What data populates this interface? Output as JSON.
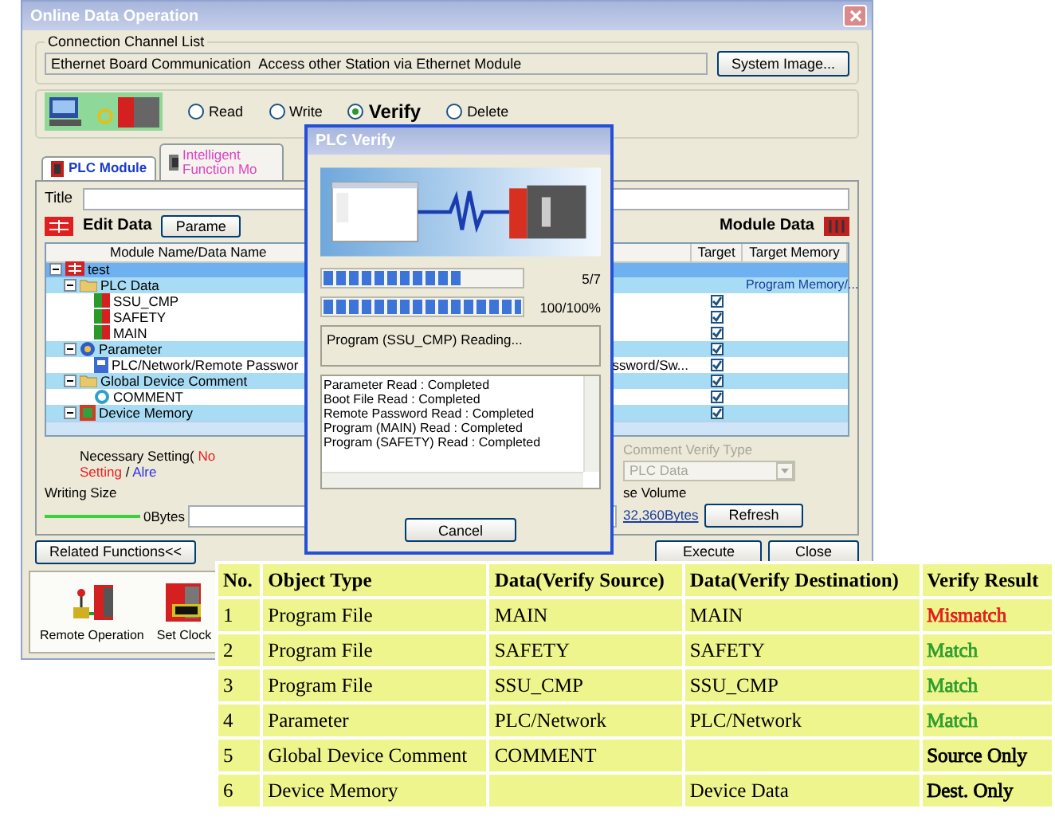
{
  "main_window": {
    "title": "Online Data Operation",
    "connection": {
      "label": "Connection Channel List",
      "value": "Ethernet Board Communication  Access other Station via Ethernet Module",
      "button": "System Image..."
    },
    "operations": [
      {
        "label": "Read",
        "selected": false
      },
      {
        "label": "Write",
        "selected": false
      },
      {
        "label": "Verify",
        "selected": true
      },
      {
        "label": "Delete",
        "selected": false
      }
    ],
    "tabs": [
      {
        "label": "PLC Module",
        "selected": true
      },
      {
        "label": "Intelligent Function Mo",
        "selected": false
      }
    ],
    "title_label": "Title",
    "edit_data": "Edit Data",
    "parameter_button": "Parame",
    "module_data": "Module Data",
    "tree": {
      "columns": [
        "Module Name/Data Name",
        "Target",
        "Target Memory"
      ],
      "items": [
        {
          "name": "test",
          "kind": "project",
          "selected": true,
          "expanded": true,
          "children": [
            {
              "name": "PLC Data",
              "kind": "folder",
              "selected": false,
              "expanded": true,
              "target_memory": "Program Memory/...",
              "children": [
                {
                  "name": "SSU_CMP",
                  "kind": "program",
                  "selected": false,
                  "checked": true
                },
                {
                  "name": "SAFETY",
                  "kind": "program",
                  "selected": false,
                  "checked": true
                },
                {
                  "name": "MAIN",
                  "kind": "program",
                  "selected": false,
                  "checked": true
                }
              ]
            },
            {
              "name": "Parameter",
              "kind": "parameter",
              "selected": false,
              "expanded": true,
              "checked": true,
              "children": [
                {
                  "name": "PLC/Network/Remote Passwor",
                  "name_tail": "ssword/Sw...",
                  "kind": "param-file",
                  "selected": false,
                  "checked": true
                }
              ]
            },
            {
              "name": "Global Device Comment",
              "kind": "folder",
              "selected": false,
              "expanded": true,
              "checked": true,
              "children": [
                {
                  "name": "COMMENT",
                  "kind": "comment",
                  "selected": false,
                  "checked": true
                }
              ]
            },
            {
              "name": "Device Memory",
              "kind": "device-memory",
              "selected": false,
              "expanded": true,
              "checked": true
            }
          ]
        }
      ]
    },
    "necessary": {
      "label": "Necessary Setting(",
      "no_setting": "No Setting",
      "separator": "/",
      "already": "Alre"
    },
    "writing_size": {
      "label": "Writing Size",
      "value": "0Bytes"
    },
    "comment_verify": {
      "label": "Comment Verify Type",
      "value": "PLC Data"
    },
    "volume": {
      "label": "se Volume",
      "value": "32,360Bytes",
      "button": "Refresh"
    },
    "related_button": "Related Functions<<",
    "execute_button": "Execute",
    "close_button": "Close",
    "related_functions": [
      {
        "label": "Remote Operation",
        "kind": "remote"
      },
      {
        "label": "Set Clock",
        "kind": "clock"
      }
    ]
  },
  "dialog": {
    "title": "PLC Verify",
    "progress": [
      {
        "level": 0.71,
        "reading": "5/7"
      },
      {
        "level": 1,
        "reading": "100/100%"
      }
    ],
    "status": "Program (SSU_CMP) Reading...",
    "log": [
      "Parameter Read : Completed",
      "Boot File Read : Completed",
      "Remote Password Read : Completed",
      "Program (MAIN) Read : Completed",
      "Program (SAFETY) Read : Completed"
    ],
    "cancel_button": "Cancel"
  },
  "results_table": {
    "columns": [
      "No.",
      "Object Type",
      "Data(Verify Source)",
      "Data(Verify Destination)",
      "Verify Result"
    ],
    "rows": [
      {
        "no": "1",
        "object_type": "Program File",
        "source": "MAIN",
        "destination": "MAIN",
        "result": "Mismatch",
        "color": "#e02020"
      },
      {
        "no": "2",
        "object_type": "Program File",
        "source": "SAFETY",
        "destination": "SAFETY",
        "result": "Match",
        "color": "#2e9e2e"
      },
      {
        "no": "3",
        "object_type": "Program File",
        "source": "SSU_CMP",
        "destination": "SSU_CMP",
        "result": "Match",
        "color": "#2e9e2e"
      },
      {
        "no": "4",
        "object_type": "Parameter",
        "source": "PLC/Network",
        "destination": "PLC/Network",
        "result": "Match",
        "color": "#2e9e2e"
      },
      {
        "no": "5",
        "object_type": "Global Device Comment",
        "source": "COMMENT",
        "result": "Source Only",
        "color": "#000000"
      },
      {
        "no": "6",
        "object_type": "Device Memory",
        "destination": "Device Data",
        "result": "Dest. Only",
        "color": "#000000"
      }
    ]
  }
}
